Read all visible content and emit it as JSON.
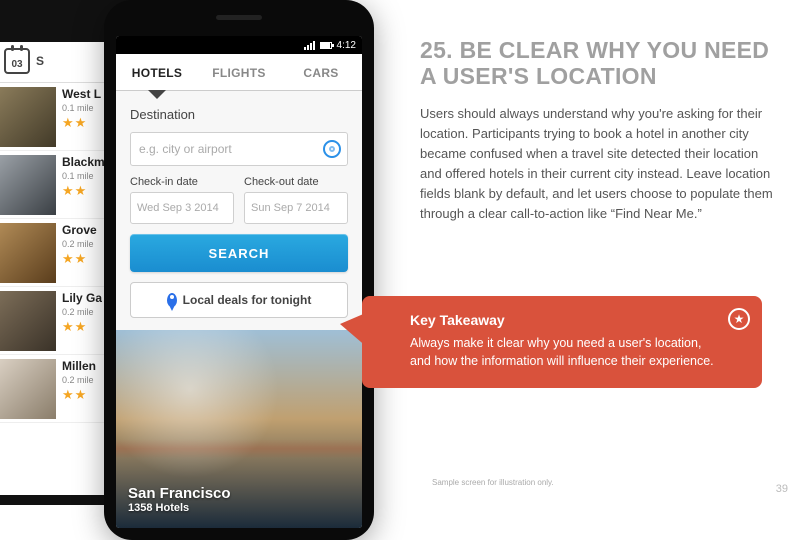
{
  "back_phone": {
    "calendar_day": "03",
    "tab_fragment": "S",
    "hotels": [
      {
        "name": "West L",
        "dist": "0.1 mile",
        "stars": "★★"
      },
      {
        "name": "Blackm",
        "dist": "0.1 mile",
        "stars": "★★"
      },
      {
        "name": "Grove",
        "dist": "0.2 mile",
        "stars": "★★"
      },
      {
        "name": "Lily Ga",
        "dist": "0.2 mile",
        "stars": "★★"
      },
      {
        "name": "Millen",
        "dist": "0.2 mile",
        "stars": "★★"
      }
    ]
  },
  "statusbar": {
    "time": "4:12"
  },
  "tabs": {
    "hotels": "HOTELS",
    "flights": "FLIGHTS",
    "cars": "CARS"
  },
  "form": {
    "dest_label": "Destination",
    "dest_placeholder": "e.g. city or airport",
    "checkin_label": "Check-in date",
    "checkin_value": "Wed Sep 3 2014",
    "checkout_label": "Check-out date",
    "checkout_value": "Sun Sep 7 2014",
    "search_label": "SEARCH",
    "deals_label": "Local deals for tonight"
  },
  "hero": {
    "city": "San Francisco",
    "count": "1358 Hotels"
  },
  "article": {
    "title": "25. BE CLEAR WHY YOU NEED A USER'S LOCATION",
    "body": "Users should always understand why you're asking for their location. Participants trying to book a hotel in another city became confused when a travel site detected their location and offered hotels in their current city instead. Leave location fields blank by default, and let users choose to populate them through a clear call-to-action like “Find Near Me.”"
  },
  "callout": {
    "title": "Key Takeaway",
    "body": "Always make it clear why you need a user's location, and how the information will influence their experience."
  },
  "caption": "Sample screen for illustration only.",
  "page_number": "39"
}
